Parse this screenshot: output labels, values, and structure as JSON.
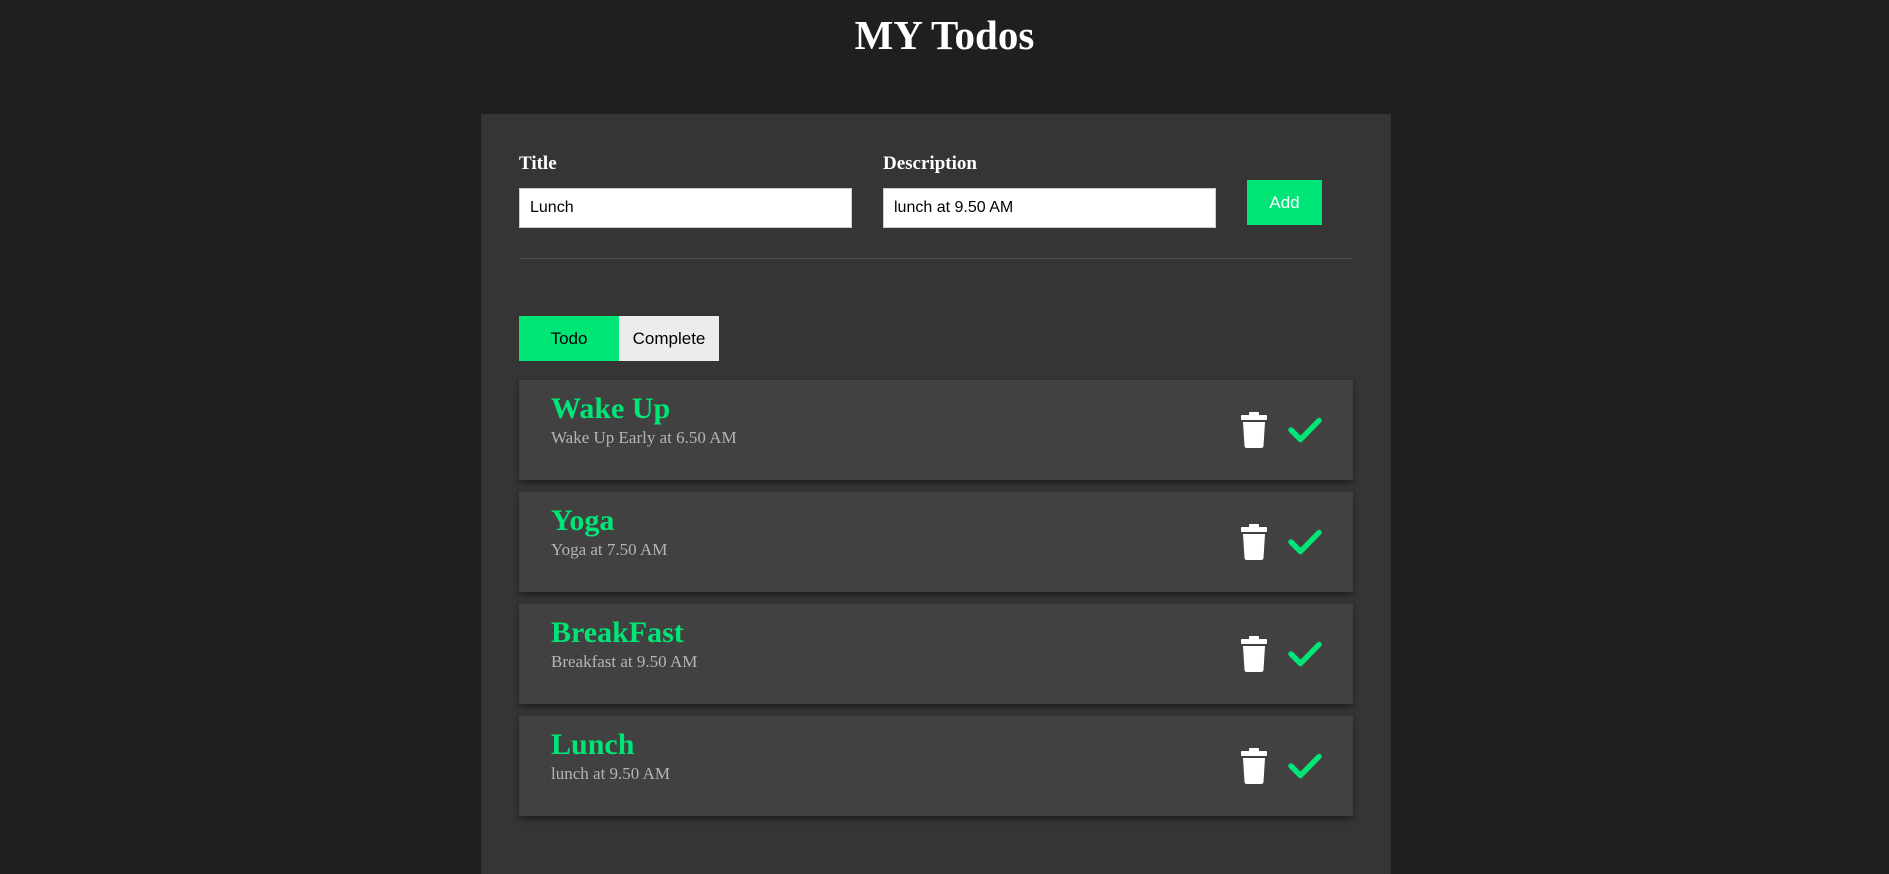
{
  "header": {
    "title": "MY Todos"
  },
  "form": {
    "title_label": "Title",
    "title_value": "Lunch",
    "description_label": "Description",
    "description_value": "lunch at 9.50 AM",
    "add_label": "Add"
  },
  "tabs": [
    {
      "label": "Todo",
      "active": true
    },
    {
      "label": "Complete",
      "active": false
    }
  ],
  "todos": [
    {
      "title": "Wake Up",
      "description": "Wake Up Early at 6.50 AM"
    },
    {
      "title": "Yoga",
      "description": "Yoga at 7.50 AM"
    },
    {
      "title": "BreakFast",
      "description": "Breakfast at 9.50 AM"
    },
    {
      "title": "Lunch",
      "description": "lunch at 9.50 AM"
    }
  ],
  "icons": {
    "delete": "trash-icon",
    "complete": "check-icon"
  },
  "colors": {
    "accent": "#00e676",
    "background": "#1f1f1f",
    "panel": "#353535",
    "card": "#414141"
  }
}
